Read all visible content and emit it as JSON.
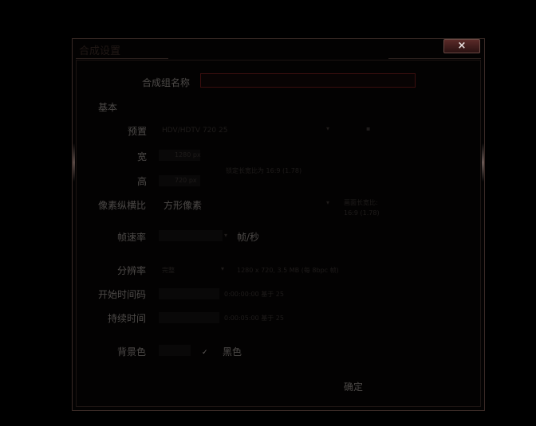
{
  "dialog": {
    "title": "合成设置",
    "close_label": "×"
  },
  "form": {
    "comp_name_label": "合成组名称",
    "comp_name_value": "",
    "basic_section": "基本",
    "preset_label": "预置",
    "preset_value": "HDV/HDTV 720 25",
    "width_label": "宽",
    "width_value": "1280 px",
    "height_label": "高",
    "height_value": "720 px",
    "lock_ratio_text": "锁定长宽比为 16:9 (1.78)",
    "pixel_aspect_label": "像素纵横比",
    "pixel_aspect_value": "方形像素",
    "frame_aspect_text": "画面长宽比:",
    "frame_aspect_value": "16:9 (1.78)",
    "frame_rate_label": "帧速率",
    "frame_rate_unit": "帧/秒",
    "resolution_label": "分辨率",
    "resolution_value": "完整",
    "resolution_info": "1280 x 720, 3.5 MB (每 8bpc 帧)",
    "start_timecode_label": "开始时间码",
    "start_timecode_info": "0:00:00:00 基于 25",
    "duration_label": "持续时间",
    "duration_info": "0:00:05:00 基于 25",
    "bg_color_label": "背景色",
    "bg_color_value": "黑色",
    "ok_label": "确定"
  },
  "colors": {
    "border": "#3a2a26",
    "close_button": "#5a2a28",
    "text": "#4d4a48",
    "input_border": "#3a0e0e"
  }
}
